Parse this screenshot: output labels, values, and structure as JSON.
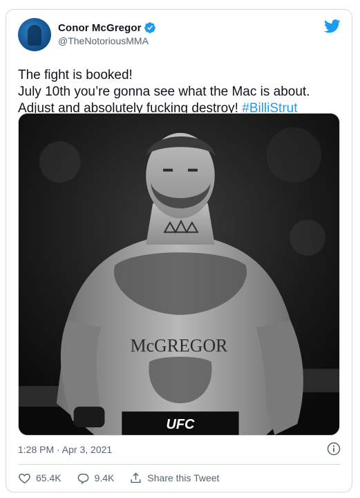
{
  "tweet": {
    "author": {
      "display_name": "Conor McGregor",
      "handle": "@TheNotoriousMMA",
      "verified": true
    },
    "text_lines": [
      "The fight is booked!",
      "July 10th you’re gonna see what the Mac is about.",
      "Adjust and absolutely fucking destroy! "
    ],
    "hashtag": "#BilliStrut",
    "media": {
      "chest_tattoo_text": "McGREGOR",
      "shorts_logo_text": "UFC"
    },
    "timestamp": "1:28 PM · Apr 3, 2021",
    "stats": {
      "likes": "65.4K",
      "replies": "9.4K",
      "share_label": "Share this Tweet"
    }
  },
  "icons": {
    "brand": "twitter-bird-icon",
    "verified": "verified-badge-icon",
    "info": "info-icon",
    "like": "heart-icon",
    "reply": "reply-bubble-icon",
    "share": "share-icon"
  },
  "colors": {
    "accent": "#1d9bf0",
    "text": "#0f1419",
    "muted": "#536471",
    "border": "#cfd9de"
  }
}
